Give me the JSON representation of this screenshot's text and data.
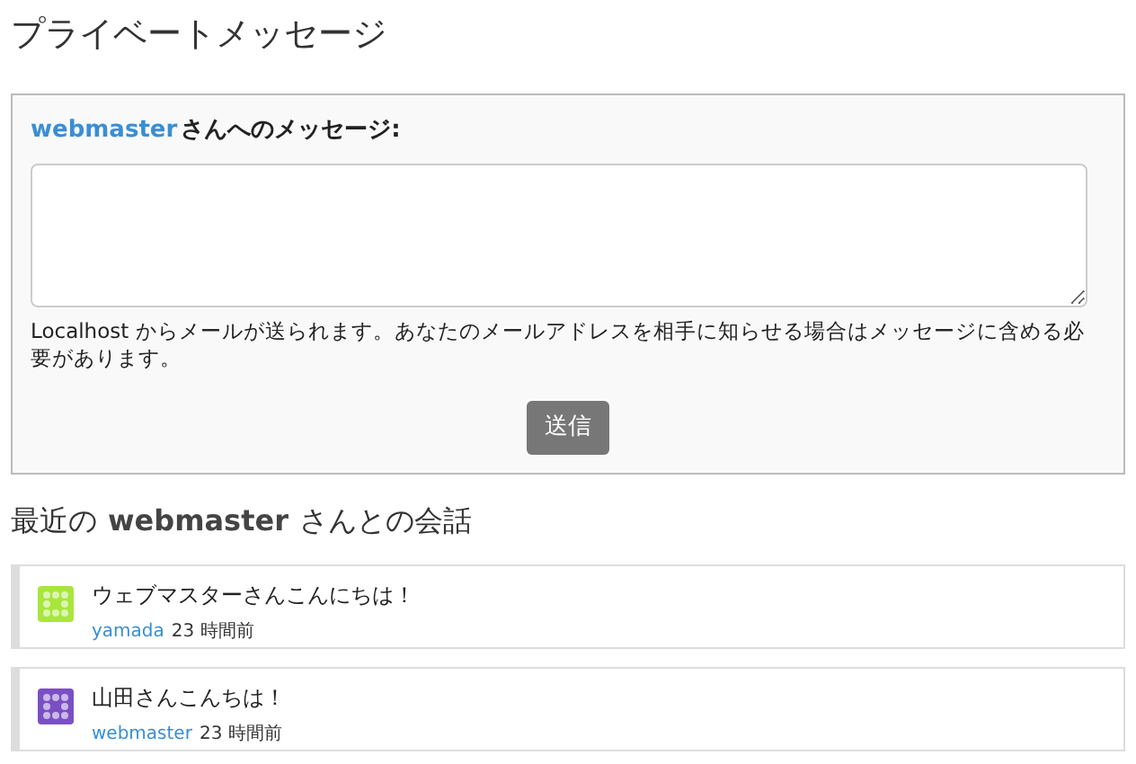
{
  "page_title": "プライベートメッセージ",
  "compose": {
    "recipient": "webmaster",
    "label_suffix": "さんへのメッセージ:",
    "notice": "Localhost からメールが送られます。あなたのメールアドレスを相手に知らせる場合はメッセージに含める必要があります。",
    "submit": "送信"
  },
  "history": {
    "prefix": "最近の",
    "user": "webmaster",
    "suffix": "さんとの会話",
    "messages": [
      {
        "text": "ウェブマスターさんこんにちは！",
        "author": "yamada",
        "time": "23 時間前",
        "color": "#a8e63c"
      },
      {
        "text": "山田さんこんちは！",
        "author": "webmaster",
        "time": "23 時間前",
        "color": "#7a4fc4"
      }
    ]
  }
}
